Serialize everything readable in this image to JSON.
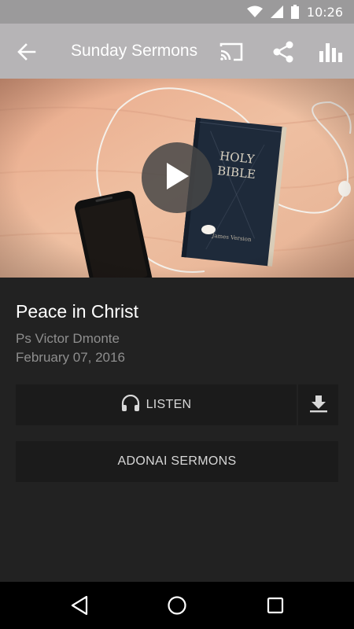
{
  "status_bar": {
    "time": "10:26",
    "icons": [
      "wifi-icon",
      "cell-signal-icon",
      "battery-icon"
    ]
  },
  "app_bar": {
    "title": "Sunday Sermons",
    "icons": [
      "back-arrow-icon",
      "cast-icon",
      "share-icon",
      "stats-icon"
    ]
  },
  "hero": {
    "image_description_icon": "bible-phone-earphones-image",
    "play_icon": "play-icon"
  },
  "sermon": {
    "title": "Peace in Christ",
    "speaker": "Ps Victor Dmonte",
    "date": "February 07, 2016"
  },
  "actions": {
    "listen_label": "LISTEN",
    "listen_icon": "headphones-icon",
    "download_icon": "download-icon",
    "series_label": "ADONAI SERMONS"
  },
  "nav_bar": {
    "icons": [
      "nav-back-icon",
      "nav-home-icon",
      "nav-recents-icon"
    ]
  },
  "colors": {
    "app_bar": "#b6b4b6",
    "status_bar": "#9b9a9b",
    "background": "#222222",
    "button": "#1b1b1b",
    "text_primary": "#ffffff",
    "text_secondary": "#8e8e8e"
  }
}
